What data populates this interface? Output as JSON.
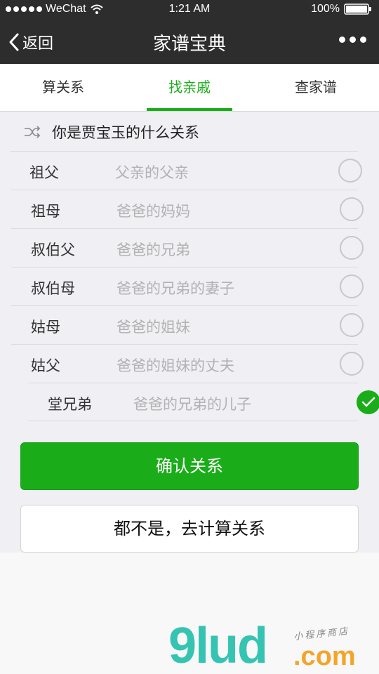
{
  "status_bar": {
    "carrier": "WeChat",
    "time": "1:21 AM",
    "battery": "100%"
  },
  "nav": {
    "back_label": "返回",
    "title": "家谱宝典"
  },
  "tabs": [
    {
      "label": "算关系",
      "active": false
    },
    {
      "label": "找亲戚",
      "active": true
    },
    {
      "label": "查家谱",
      "active": false
    }
  ],
  "question": "你是贾宝玉的什么关系",
  "relations": [
    {
      "term": "祖父",
      "desc": "父亲的父亲",
      "checked": false
    },
    {
      "term": "祖母",
      "desc": "爸爸的妈妈",
      "checked": false
    },
    {
      "term": "叔伯父",
      "desc": "爸爸的兄弟",
      "checked": false
    },
    {
      "term": "叔伯母",
      "desc": "爸爸的兄弟的妻子",
      "checked": false
    },
    {
      "term": "姑母",
      "desc": "爸爸的姐妹",
      "checked": false
    },
    {
      "term": "姑父",
      "desc": "爸爸的姐妹的丈夫",
      "checked": false
    },
    {
      "term": "堂兄弟",
      "desc": "爸爸的兄弟的儿子",
      "checked": true
    }
  ],
  "buttons": {
    "confirm": "确认关系",
    "none": "都不是，去计算关系"
  },
  "watermark": {
    "main": "9lud",
    "domain": ".com",
    "sub": "小程序商店"
  },
  "colors": {
    "accent": "#1aad19",
    "nav_bg": "#2d2d2d"
  }
}
